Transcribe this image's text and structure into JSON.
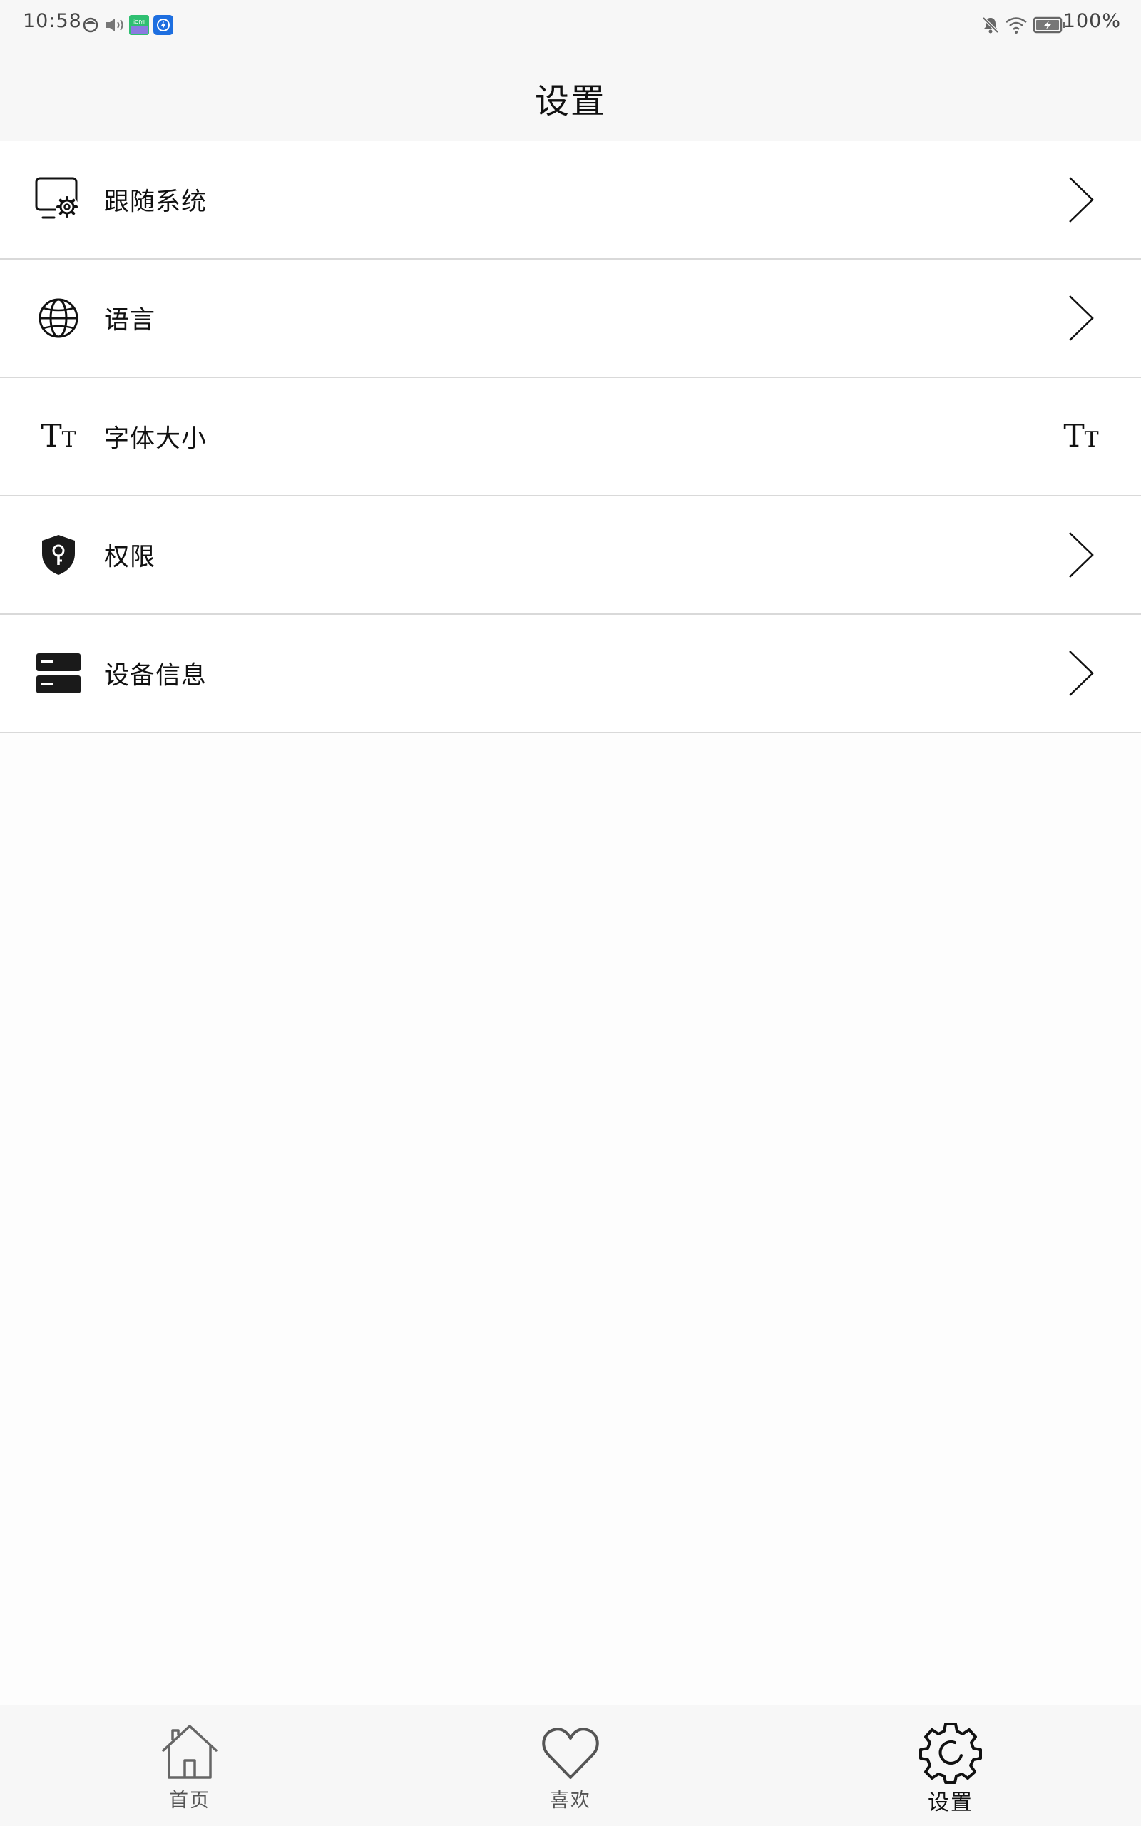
{
  "status_bar": {
    "time": "10:58",
    "battery_percent": "100%"
  },
  "header": {
    "title": "设置"
  },
  "settings": {
    "items": [
      {
        "label": "跟随系统",
        "icon": "display-settings-icon",
        "right": "chevron-right-icon"
      },
      {
        "label": "语言",
        "icon": "globe-icon",
        "right": "chevron-right-icon"
      },
      {
        "label": "字体大小",
        "icon": "font-size-icon",
        "right": "font-size-icon"
      },
      {
        "label": "权限",
        "icon": "shield-key-icon",
        "right": "chevron-right-icon"
      },
      {
        "label": "设备信息",
        "icon": "server-icon",
        "right": "chevron-right-icon"
      }
    ],
    "font_size_glyph_big": "T",
    "font_size_glyph_small": "T"
  },
  "bottom_nav": {
    "items": [
      {
        "label": "首页",
        "icon": "home-icon",
        "active": false
      },
      {
        "label": "喜欢",
        "icon": "heart-icon",
        "active": false
      },
      {
        "label": "设置",
        "icon": "gear-icon",
        "active": true
      }
    ]
  }
}
